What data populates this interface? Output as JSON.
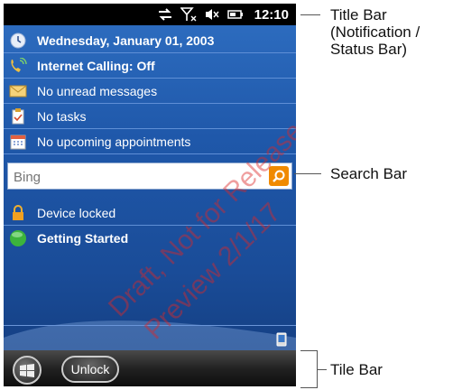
{
  "status_bar": {
    "time": "12:10"
  },
  "today_rows": [
    {
      "icon": "clock-icon",
      "text": "Wednesday, January 01, 2003",
      "bold": true
    },
    {
      "icon": "phone-icon",
      "text": "Internet Calling: Off",
      "bold": true
    },
    {
      "icon": "envelope-icon",
      "text": "No unread messages",
      "bold": false
    },
    {
      "icon": "tasks-icon",
      "text": "No tasks",
      "bold": false
    },
    {
      "icon": "calendar-icon",
      "text": "No upcoming appointments",
      "bold": false
    }
  ],
  "search": {
    "placeholder": "Bing"
  },
  "lower_rows": [
    {
      "icon": "lock-icon",
      "text": "Device locked"
    },
    {
      "icon": "getting-started-icon",
      "text": "Getting Started"
    }
  ],
  "tile_bar": {
    "unlock_label": "Unlock"
  },
  "callouts": {
    "title_bar_line1": "Title Bar",
    "title_bar_line2": "(Notification /",
    "title_bar_line3": "Status Bar)",
    "search_bar": "Search Bar",
    "tile_bar": "Tile Bar"
  },
  "watermark": {
    "line1": "Draft, Not for Release",
    "line2": "Preview 2/1/17"
  },
  "colors": {
    "accent_orange": "#f08a00",
    "screen_blue": "#1f58aa"
  }
}
